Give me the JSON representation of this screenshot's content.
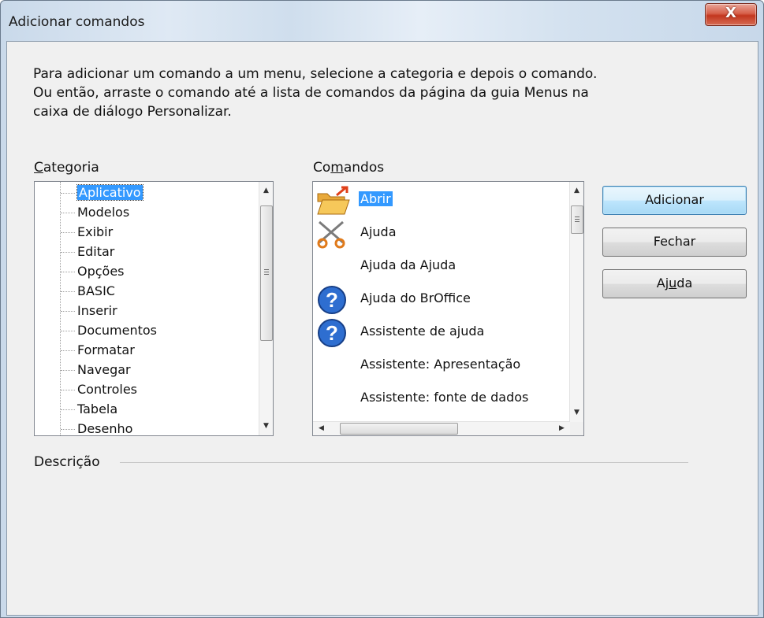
{
  "window": {
    "title": "Adicionar comandos",
    "close_label": "X"
  },
  "instructions": "Para adicionar um comando a um menu, selecione a categoria e depois o comando. Ou então, arraste o comando até a lista de comandos da página da guia Menus na caixa de diálogo Personalizar.",
  "category": {
    "label_accel": "C",
    "label_rest": "ategoria",
    "selected": "Aplicativo",
    "items": [
      "Aplicativo",
      "Modelos",
      "Exibir",
      "Editar",
      "Opções",
      "BASIC",
      "Inserir",
      "Documentos",
      "Formatar",
      "Navegar",
      "Controles",
      "Tabela",
      "Desenho"
    ]
  },
  "commands": {
    "label_pre": "Co",
    "label_accel": "m",
    "label_post": "andos",
    "selected": "Abrir",
    "items": [
      {
        "label": "Abrir",
        "icon": "open-folder-icon"
      },
      {
        "label": "Ajuda",
        "icon": "scissors-icon"
      },
      {
        "label": "Ajuda da Ajuda",
        "icon": ""
      },
      {
        "label": "Ajuda do BrOffice",
        "icon": "help-question-icon"
      },
      {
        "label": "Assistente de ajuda",
        "icon": "help-question-icon"
      },
      {
        "label": "Assistente: Apresentação",
        "icon": ""
      },
      {
        "label": "Assistente: fonte de dados",
        "icon": ""
      }
    ]
  },
  "buttons": {
    "add": "Adicionar",
    "close": "Fechar",
    "help_pre": "Aj",
    "help_accel": "u",
    "help_post": "da"
  },
  "description": {
    "label": "Descrição"
  },
  "scroll_glyphs": {
    "up": "▲",
    "down": "▼",
    "left": "◀",
    "right": "▶"
  },
  "colors": {
    "selection": "#3399ff",
    "close_button": "#c2361e"
  }
}
